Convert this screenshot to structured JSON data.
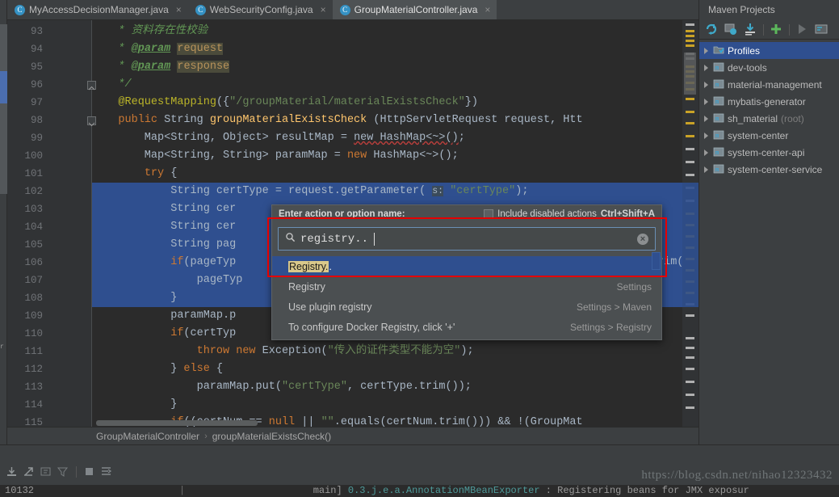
{
  "window": {
    "tabs": [
      {
        "label": "MyAccessDecisionManager.java",
        "icon": "class-icon",
        "active": false,
        "close": "×"
      },
      {
        "label": "WebSecurityConfig.java",
        "icon": "class-icon",
        "active": false,
        "close": "×"
      },
      {
        "label": "GroupMaterialController.java",
        "icon": "class-icon",
        "active": true,
        "close": "×"
      }
    ]
  },
  "editor": {
    "first_line_number": 93,
    "line_numbers": [
      93,
      94,
      95,
      96,
      97,
      98,
      99,
      100,
      101,
      102,
      103,
      104,
      105,
      106,
      107,
      108,
      109,
      110,
      111,
      112,
      113,
      114,
      115
    ],
    "lines": [
      {
        "n": 93,
        "html": "    <span class='cmt'>*</span> <span class='cmt'>资料存在性校验</span>"
      },
      {
        "n": 94,
        "html": "    <span class='cmt'>*</span> <span class='tag'>@param</span> <span class='pname'>request</span>"
      },
      {
        "n": 95,
        "html": "    <span class='cmt'>*</span> <span class='tag'>@param</span> <span class='pname'>response</span>"
      },
      {
        "n": 96,
        "html": "    <span class='cmt'>*/</span>"
      },
      {
        "n": 97,
        "html": "    <span class='ann'>@RequestMapping</span>({<span class='str'>\"/groupMaterial/materialExistsCheck\"</span>})"
      },
      {
        "n": 98,
        "html": "    <span class='kw'>public</span> String <span class='fn'>groupMaterialExistsCheck</span> (HttpServletRequest request, Htt"
      },
      {
        "n": 99,
        "html": "        Map&lt;String, Object&gt; resultMap = <span class='err-squig'>new HashMap&lt;~&gt;()</span>;"
      },
      {
        "n": 100,
        "html": "        Map&lt;String, String&gt; paramMap = <span class='kw'>new</span> HashMap&lt;~&gt;();"
      },
      {
        "n": 101,
        "html": "        <span class='kw'>try</span> {"
      },
      {
        "n": 102,
        "html": "            String certType = request.getParameter( <span class='hint'>s:</span> <span class='str'>\"certType\"</span>);"
      },
      {
        "n": 103,
        "html": "            String cer"
      },
      {
        "n": 104,
        "html": "            String cer"
      },
      {
        "n": 105,
        "html": "            String pag"
      },
      {
        "n": 106,
        "html": "            <span class='kw'>if</span>(pageTyp"
      },
      {
        "n": 107,
        "html": "                pageTyp"
      },
      {
        "n": 108,
        "html": "            }"
      },
      {
        "n": 109,
        "html": "            paramMap.p"
      },
      {
        "n": 110,
        "html": "            <span class='kw'>if</span>(certTyp"
      },
      {
        "n": 111,
        "html": "                <span class='kw'>throw new</span> Exception(<span class='str'>\"传入的证件类型不能为空\"</span>);"
      },
      {
        "n": 112,
        "html": "            } <span class='kw'>else</span> {"
      },
      {
        "n": 113,
        "html": "                paramMap.put(<span class='str'>\"certType\"</span>, certType.trim());"
      },
      {
        "n": 114,
        "html": "            }"
      },
      {
        "n": 115,
        "html": "            <span class='kw'>if</span>((certNum == <span class='kw'>null</span> || <span class='str'>\"\"</span>.equals(certNum.trim())) &amp;&amp; !(GroupMat"
      }
    ],
    "trailing_fragment_line_106": "rim()",
    "selection": {
      "from_line": 102,
      "to_line": 108
    },
    "gutter_icons": [
      {
        "line": 98,
        "name": "run-gutter-icon"
      },
      {
        "line": 98,
        "name": "spring-bean-gutter-icon"
      }
    ]
  },
  "breadcrumb": {
    "class": "GroupMaterialController",
    "separator": "›",
    "method": "groupMaterialExistsCheck()"
  },
  "goto_action_dialog": {
    "title": "Enter action or option name:",
    "include_disabled_label": "Include disabled actions",
    "include_disabled_shortcut": "Ctrl+Shift+A",
    "search_icon": "search-icon",
    "query": "registry..",
    "clear_icon": "×",
    "results": [
      {
        "label_highlight": "Registry.",
        "label_rest": ".",
        "right": "",
        "selected": true
      },
      {
        "label_highlight": "",
        "label_rest": "Registry",
        "right": "Settings",
        "selected": false
      },
      {
        "label_highlight": "",
        "label_rest": "Use plugin registry",
        "right": "Settings > Maven",
        "selected": false
      },
      {
        "label_highlight": "",
        "label_rest": "To configure Docker Registry, click '+'",
        "right": "Settings > Registry",
        "selected": false
      }
    ]
  },
  "maven_panel": {
    "title": "Maven Projects",
    "toolbar": [
      {
        "name": "reimport-icon"
      },
      {
        "name": "generate-sources-icon"
      },
      {
        "name": "download-sources-icon"
      },
      {
        "name": "add-maven-project-icon"
      },
      {
        "name": "run-maven-build-icon"
      },
      {
        "name": "execute-goal-icon"
      }
    ],
    "tree": [
      {
        "label": "Profiles",
        "suffix": "",
        "icon": "profiles-icon",
        "selected": true
      },
      {
        "label": "dev-tools",
        "suffix": "",
        "icon": "maven-module-icon",
        "selected": false
      },
      {
        "label": "material-management",
        "suffix": "",
        "icon": "maven-module-icon",
        "selected": false
      },
      {
        "label": "mybatis-generator",
        "suffix": "",
        "icon": "maven-module-icon",
        "selected": false
      },
      {
        "label": "sh_material",
        "suffix": "(root)",
        "icon": "maven-module-icon",
        "selected": false
      },
      {
        "label": "system-center",
        "suffix": "",
        "icon": "maven-module-icon",
        "selected": false
      },
      {
        "label": "system-center-api",
        "suffix": "",
        "icon": "maven-module-icon",
        "selected": false
      },
      {
        "label": "system-center-service",
        "suffix": "",
        "icon": "maven-module-icon",
        "selected": false
      }
    ]
  },
  "bottom": {
    "toolbar_icons": [
      {
        "name": "export-to-file-icon"
      },
      {
        "name": "open-in-browser-icon"
      },
      {
        "name": "print-icon"
      },
      {
        "name": "filter-icon"
      },
      {
        "name": "stop-icon"
      },
      {
        "name": "soft-wrap-icon"
      }
    ],
    "watermark": "https://blog.csdn.net/nihao12323432",
    "console_pid": "10132",
    "console_thread": "main]",
    "console_logger": "0.3.j.e.a.AnnotationMBeanExporter",
    "console_message": ": Registering beans for JMX exposur"
  },
  "colors": {
    "accent_blue": "#2f4f8f",
    "editor_bg": "#2b2b2b",
    "panel_bg": "#3c3f41",
    "highlight_red": "#e60000",
    "string_green": "#6a8759",
    "keyword_orange": "#cc7832"
  }
}
